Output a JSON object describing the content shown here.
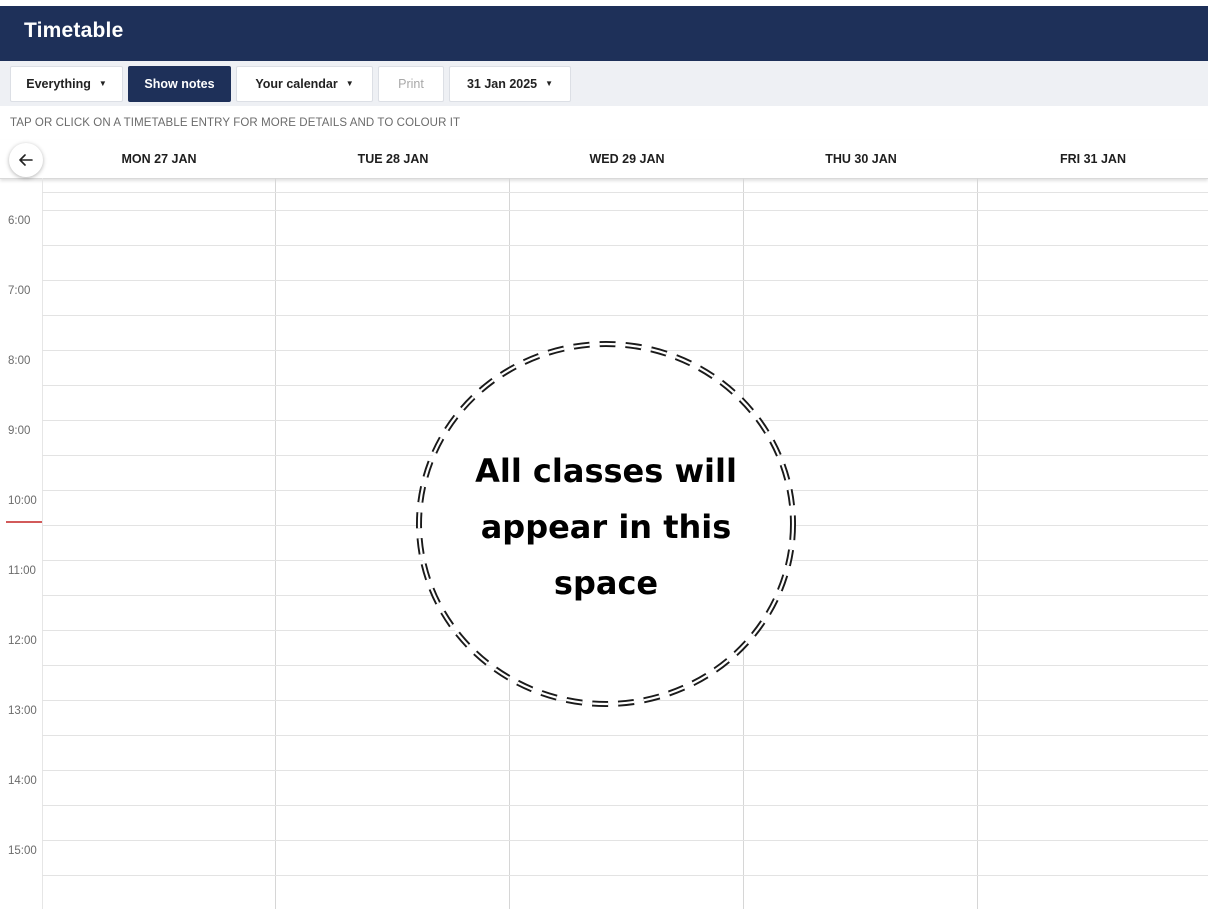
{
  "app": {
    "title": "Timetable"
  },
  "toolbar": {
    "everything_label": "Everything",
    "show_notes_label": "Show notes",
    "calendar_label": "Your calendar",
    "print_label": "Print",
    "date_label": "31 Jan 2025"
  },
  "hint": "TAP OR CLICK ON A TIMETABLE ENTRY FOR MORE DETAILS AND TO COLOUR IT",
  "days": [
    "MON 27 JAN",
    "TUE 28 JAN",
    "WED 29 JAN",
    "THU 30 JAN",
    "FRI 31 JAN"
  ],
  "hours": [
    "6:00",
    "7:00",
    "8:00",
    "9:00",
    "10:00",
    "11:00",
    "12:00",
    "13:00",
    "14:00",
    "15:00"
  ],
  "callout": {
    "text": "All classes will appear in this space"
  },
  "colors": {
    "header": "#1e3059",
    "toolbar": "#eef0f4",
    "now_line": "#d25a5a"
  },
  "icons": {
    "back": "arrow-left-icon",
    "dropdown": "caret-down-icon"
  }
}
